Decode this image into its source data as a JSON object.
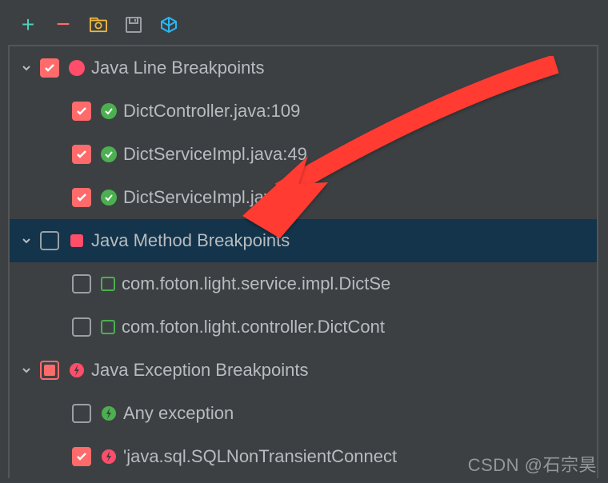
{
  "toolbar": {
    "add": "+",
    "remove": "−"
  },
  "tree": {
    "groups": [
      {
        "label": "Java Line Breakpoints",
        "items": [
          {
            "label": "DictController.java:109"
          },
          {
            "label": "DictServiceImpl.java:49"
          },
          {
            "label": "DictServiceImpl.java:51"
          }
        ]
      },
      {
        "label": "Java Method Breakpoints",
        "items": [
          {
            "label": "com.foton.light.service.impl.DictSe"
          },
          {
            "label": "com.foton.light.controller.DictCont"
          }
        ]
      },
      {
        "label": "Java Exception Breakpoints",
        "items": [
          {
            "label": "Any exception"
          },
          {
            "label": "'java.sql.SQLNonTransientConnect"
          }
        ]
      }
    ]
  },
  "watermark": "CSDN @石宗昊"
}
